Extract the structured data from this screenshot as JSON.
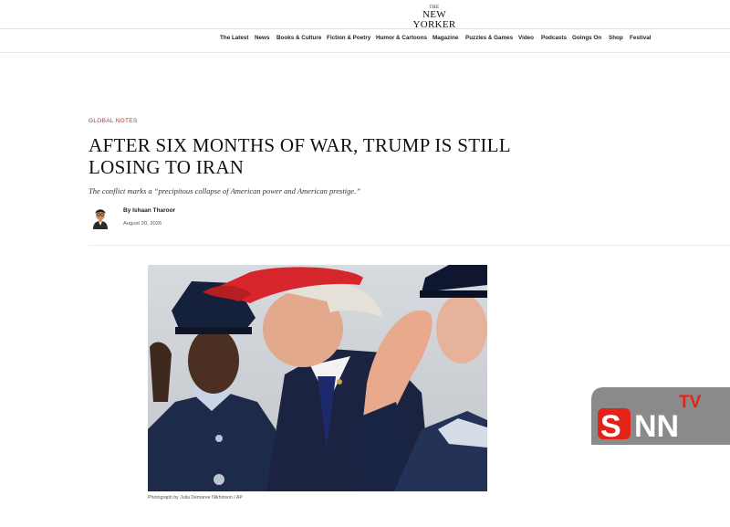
{
  "masthead": {
    "logo_the": "THE",
    "logo_name": "NEW YORKER"
  },
  "nav": {
    "items": [
      "The Latest",
      "News",
      "Books & Culture",
      "Fiction & Poetry",
      "Humor & Cartoons",
      "Magazine",
      "Puzzles & Games",
      "Video",
      "Podcasts",
      "Goings On",
      "Shop",
      "Festival"
    ]
  },
  "article": {
    "rubric": "GLOBAL NOTES",
    "headline_line1": "AFTER SIX MONTHS OF WAR, TRUMP IS STILL",
    "headline_line2": "LOSING TO IRAN",
    "dek": "The conflict marks a “precipitous collapse of American power and American prestige.”",
    "byline_prefix": "By",
    "author": "Ishaan Tharoor",
    "date": "August 20, 2026",
    "photo_caption": "Photograph by Julia Demaree Nikhinson / AP"
  },
  "watermark": {
    "tv": "TV",
    "s": "S",
    "nn": "NN"
  },
  "colors": {
    "rubric": "#b1323a",
    "cap_red": "#d7262b",
    "watermark_red": "#e2231a",
    "watermark_gray": "#8a8a8a"
  }
}
